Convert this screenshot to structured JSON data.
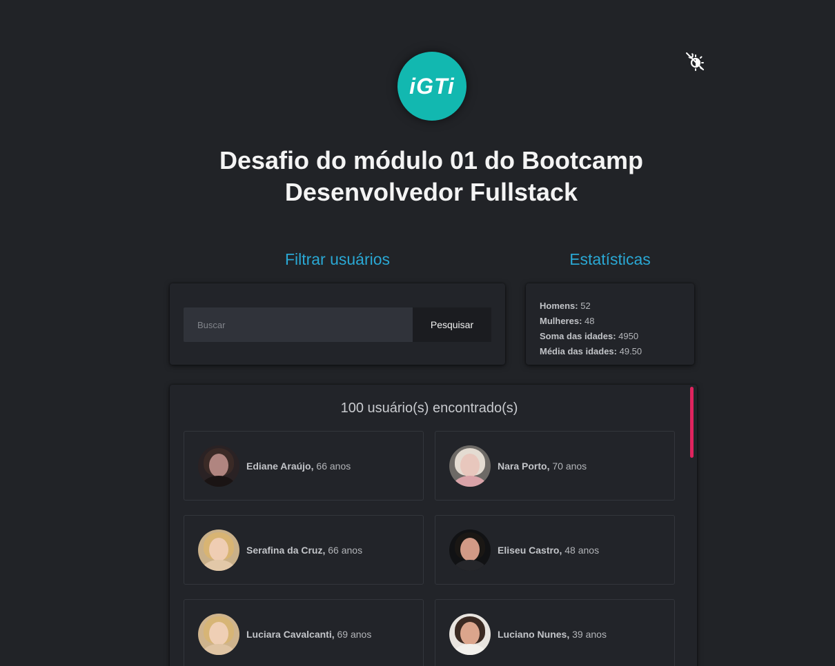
{
  "header": {
    "logo_text": "iGTi",
    "title_line1": "Desafio do módulo 01 do Bootcamp",
    "title_line2": "Desenvolvedor Fullstack",
    "theme_toggle_icon": "moon-sun-toggle-icon"
  },
  "filter": {
    "heading": "Filtrar usuários",
    "search_placeholder": "Buscar",
    "search_value": "",
    "button_label": "Pesquisar"
  },
  "stats": {
    "heading": "Estatísticas",
    "items": [
      {
        "label": "Homens:",
        "value": "52"
      },
      {
        "label": "Mulheres:",
        "value": "48"
      },
      {
        "label": "Soma das idades:",
        "value": "4950"
      },
      {
        "label": "Média das idades:",
        "value": "49.50"
      }
    ]
  },
  "users": {
    "count_text": "100 usuário(s) encontrado(s)",
    "list": [
      {
        "name": "Ediane Araújo,",
        "age": "66 anos"
      },
      {
        "name": "Nara Porto,",
        "age": "70 anos"
      },
      {
        "name": "Serafina da Cruz,",
        "age": "66 anos"
      },
      {
        "name": "Eliseu Castro,",
        "age": "48 anos"
      },
      {
        "name": "Luciara Cavalcanti,",
        "age": "69 anos"
      },
      {
        "name": "Luciano Nunes,",
        "age": "39 anos"
      }
    ]
  },
  "colors": {
    "background": "#212327",
    "accent": "#2aa8d4",
    "logo": "#12b8b0",
    "scrollbar": "#e0245e"
  }
}
